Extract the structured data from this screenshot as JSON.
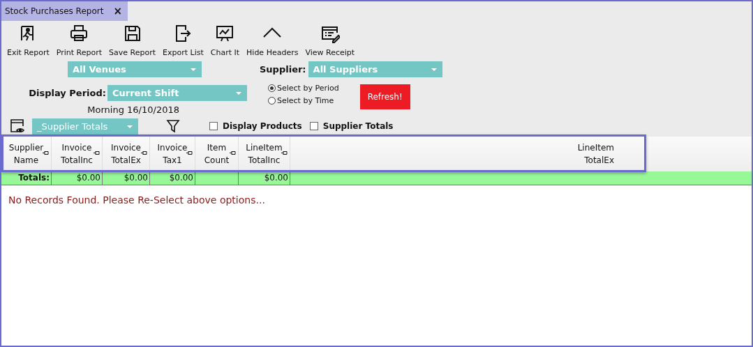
{
  "tab": {
    "title": "Stock Purchases Report",
    "close": "×",
    "selected": true
  },
  "toolbar": [
    {
      "label": "Exit Report",
      "kind": "exit"
    },
    {
      "label": "Print Report",
      "kind": "print"
    },
    {
      "label": "Save Report",
      "kind": "save"
    },
    {
      "label": "Export List",
      "kind": "export"
    },
    {
      "label": "Chart It",
      "kind": "chart"
    },
    {
      "label": "Hide Headers",
      "kind": "collapse"
    },
    {
      "label": "View Receipt",
      "kind": "receipt"
    }
  ],
  "venue": {
    "value": "All Venues"
  },
  "supplier": {
    "label": "Supplier:",
    "value": "All Suppliers"
  },
  "period": {
    "label": "Display Period:",
    "value": "Current Shift",
    "caption": "Morning 16/10/2018"
  },
  "select_mode": [
    {
      "label": "Select by Period",
      "selected": true
    },
    {
      "label": "Select  by Time",
      "selected": false
    }
  ],
  "refresh": "Refresh!",
  "view": {
    "value": "_Supplier Totals"
  },
  "options": [
    {
      "label": "Display Products",
      "checked": false
    },
    {
      "label": "Supplier Totals",
      "checked": false
    }
  ],
  "table": {
    "columns": [
      {
        "line1": "Supplier",
        "line2": "Name",
        "pinned": true,
        "total": "Totals:"
      },
      {
        "line1": "Invoice",
        "line2": "TotalInc",
        "pinned": true,
        "total": "$0.00"
      },
      {
        "line1": "Invoice",
        "line2": "TotalEx",
        "pinned": true,
        "total": "$0.00"
      },
      {
        "line1": "Invoice",
        "line2": "Tax1",
        "pinned": true,
        "total": "$0.00"
      },
      {
        "line1": "Item",
        "line2": "Count",
        "pinned": true
      },
      {
        "line1": "LineItem",
        "line2": "TotalInc",
        "pinned": true,
        "total": "$0.00"
      },
      {
        "line1": "LineItem",
        "line2": "TotalEx",
        "pinned": false
      }
    ],
    "message": "No Records Found. Please Re-Select above options..."
  }
}
